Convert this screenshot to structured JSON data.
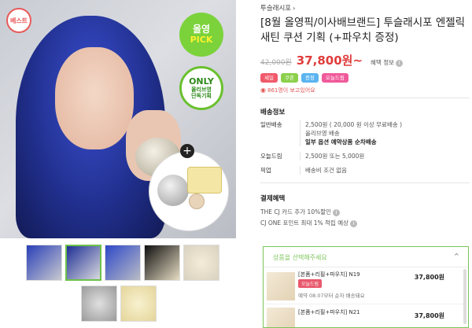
{
  "product_image": {
    "best_badge": "베스트",
    "pick_badge_line1": "올영",
    "pick_badge_line2": "PICK",
    "only_badge_line1": "ONLY",
    "only_badge_line2": "올리브영",
    "only_badge_line3": "단독기획",
    "plus_sign": "+"
  },
  "thumbnails": [
    "thumb-1",
    "thumb-2",
    "thumb-3",
    "thumb-4",
    "thumb-5",
    "thumb-6",
    "thumb-7"
  ],
  "brand": {
    "name": "투슬래시포",
    "arrow": "›"
  },
  "title": "[8월 올영픽/이사배브랜드] 투슬래시포 엔젤릭 새틴 쿠션 기획 (+파우치 증정)",
  "price": {
    "original": "42,000원",
    "sale": "37,800원~",
    "benefit_label": "혜택 정보",
    "info_icon": "i"
  },
  "tags": [
    {
      "label": "세일",
      "color": "#f05a6b"
    },
    {
      "label": "쿠폰",
      "color": "#8bd04b"
    },
    {
      "label": "증정",
      "color": "#5bb4f0"
    },
    {
      "label": "오늘드림",
      "color": "#f05a9a"
    }
  ],
  "viewers": "861명이 보고있어요",
  "shipping": {
    "title": "배송정보",
    "general_label": "일반배송",
    "general_line1": "2,500원 ( 20,000 원 이상 무료배송 )",
    "general_line2": "올리브영 배송",
    "general_line3": "일부 옵션 예약상품 순차배송",
    "today_label": "오늘드림",
    "today_value": "2,500원 또는 5,000원",
    "pickup_label": "픽업",
    "pickup_value": "배송비 조건 없음"
  },
  "payment": {
    "title": "결제혜택",
    "perk1": "THE CJ 카드 추가 10%할인",
    "perk2": "CJ ONE 포인트 최대 1% 적립 예상"
  },
  "options": {
    "header": "상품을 선택해주세요",
    "chevron": "⌃",
    "items": [
      {
        "name": "[본품+리필+파우치] N19",
        "tag": "오늘드림",
        "sub": "예약 08.07부터 순차 배송돼요",
        "price": "37,800원"
      },
      {
        "name": "[본품+리필+파우치] N21",
        "tag": "",
        "sub": "",
        "price": "37,800원"
      }
    ]
  }
}
